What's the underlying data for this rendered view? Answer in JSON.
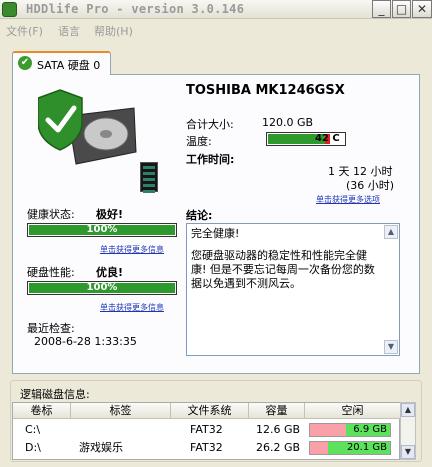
{
  "window": {
    "title": "HDDlife Pro - version 3.0.146",
    "buttons": {
      "minimize": "_",
      "maximize": "□",
      "close": "✕"
    }
  },
  "menu": {
    "items": [
      "文件(F)",
      "语言",
      "帮助(H)"
    ]
  },
  "tab": {
    "label": "SATA 硬盘 0"
  },
  "drive": {
    "model": "TOSHIBA MK1246GSX",
    "capacity_label": "合计大小:",
    "capacity_value": "120.0 GB",
    "temperature_label": "温度:",
    "temperature_value": "42°C",
    "temperature_display": "42 C",
    "temperature_fraction": 0.75,
    "worktime_label": "工作时间:",
    "worktime_value": "1 天 12 小时",
    "worktime_hours": "(36 小时)",
    "more_options_link": "单击获得更多选项"
  },
  "health": {
    "label": "健康状态:",
    "status": "极好!",
    "percent": 100,
    "percent_text": "100%",
    "more_info_link": "单击获得更多信息"
  },
  "performance": {
    "label": "硬盘性能:",
    "status": "优良!",
    "percent": 100,
    "percent_text": "100%",
    "more_info_link": "单击获得更多信息"
  },
  "last_check": {
    "label": "最近检查:",
    "value": "2008-6-28 1:33:35"
  },
  "conclusion": {
    "label": "结论:",
    "line1": "完全健康!",
    "body": "您硬盘驱动器的稳定性和性能完全健康! 但是不要忘记每周一次备份您的数据以免遇到不测风云。"
  },
  "logical_disks": {
    "label": "逻辑磁盘信息:",
    "columns": [
      "卷标",
      "标签",
      "文件系统",
      "容量",
      "空闲"
    ],
    "rows": [
      {
        "volume": "C:\\",
        "label": "",
        "fs": "FAT32",
        "capacity": "12.6 GB",
        "free": "6.9 GB",
        "free_fraction": 0.55
      },
      {
        "volume": "D:\\",
        "label": "游戏娱乐",
        "fs": "FAT32",
        "capacity": "26.2 GB",
        "free": "20.1 GB",
        "free_fraction": 0.77
      }
    ]
  },
  "colors": {
    "ok_green": "#2e9a2e",
    "link_blue": "#1d36b6",
    "used_pink": "#f9a0a8",
    "free_green": "#5ce25c",
    "tab_accent": "#e68b2c"
  }
}
